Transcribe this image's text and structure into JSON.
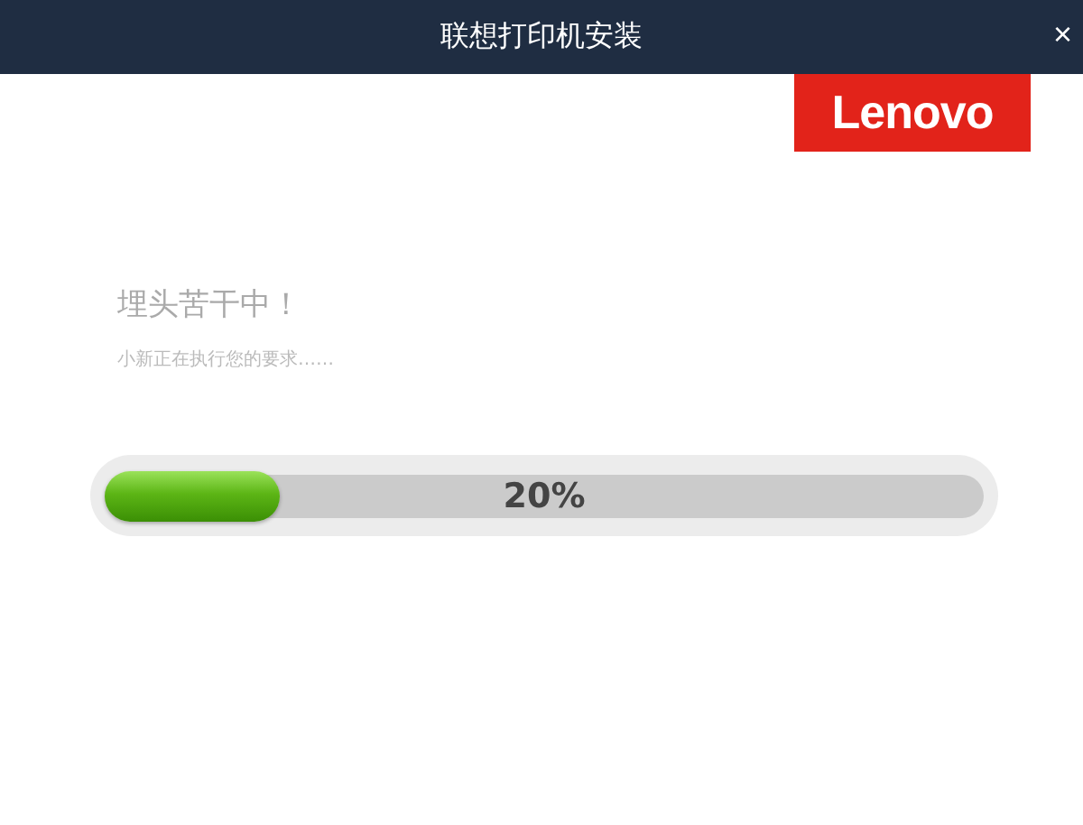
{
  "window": {
    "title": "联想打印机安装",
    "close": "×"
  },
  "logo": {
    "text": "Lenovo"
  },
  "status": {
    "heading": "埋头苦干中！",
    "message": "小新正在执行您的要求……"
  },
  "progress": {
    "level": 0.2,
    "reading": "20%"
  }
}
